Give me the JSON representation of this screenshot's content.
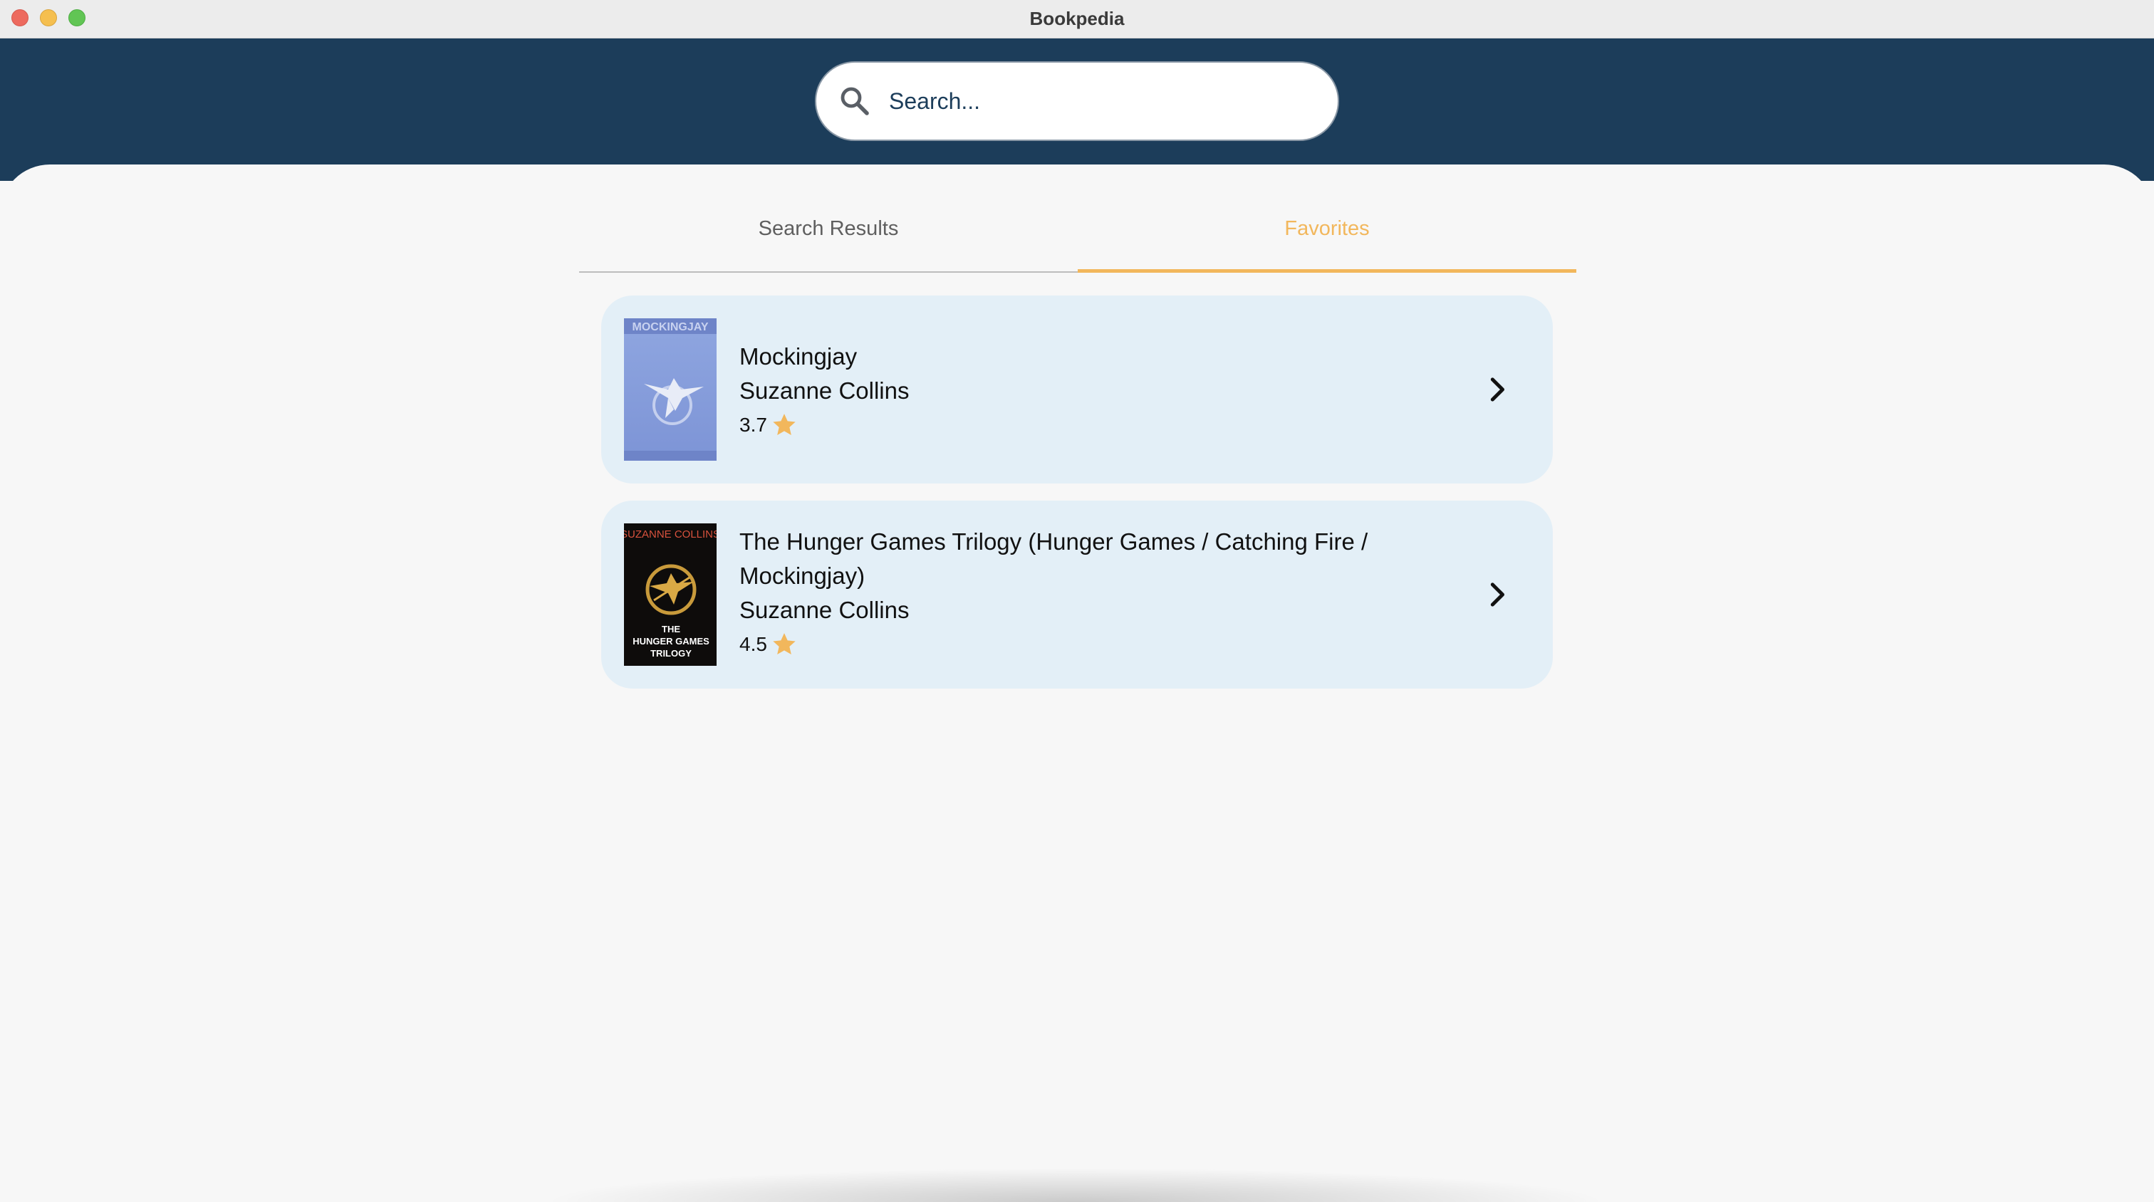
{
  "window": {
    "title": "Bookpedia"
  },
  "search": {
    "placeholder": "Search...",
    "value": ""
  },
  "tabs": [
    {
      "label": "Search Results",
      "selected": false
    },
    {
      "label": "Favorites",
      "selected": true
    }
  ],
  "colors": {
    "header": "#1c3d5a",
    "accent": "#f2b75c",
    "card": "#e3eff7",
    "background": "#f7f7f7"
  },
  "books": [
    {
      "title": "Mockingjay",
      "author": "Suzanne Collins",
      "rating": "3.7",
      "cover_icon": "mockingjay-cover"
    },
    {
      "title": "The Hunger Games Trilogy (Hunger Games / Catching Fire / Mockingjay)",
      "author": "Suzanne Collins",
      "rating": "4.5",
      "cover_icon": "hunger-games-trilogy-cover",
      "cover_text": {
        "top": "SUZANNE COLLINS",
        "line1": "THE",
        "line2": "HUNGER GAMES",
        "line3": "TRILOGY"
      }
    }
  ]
}
